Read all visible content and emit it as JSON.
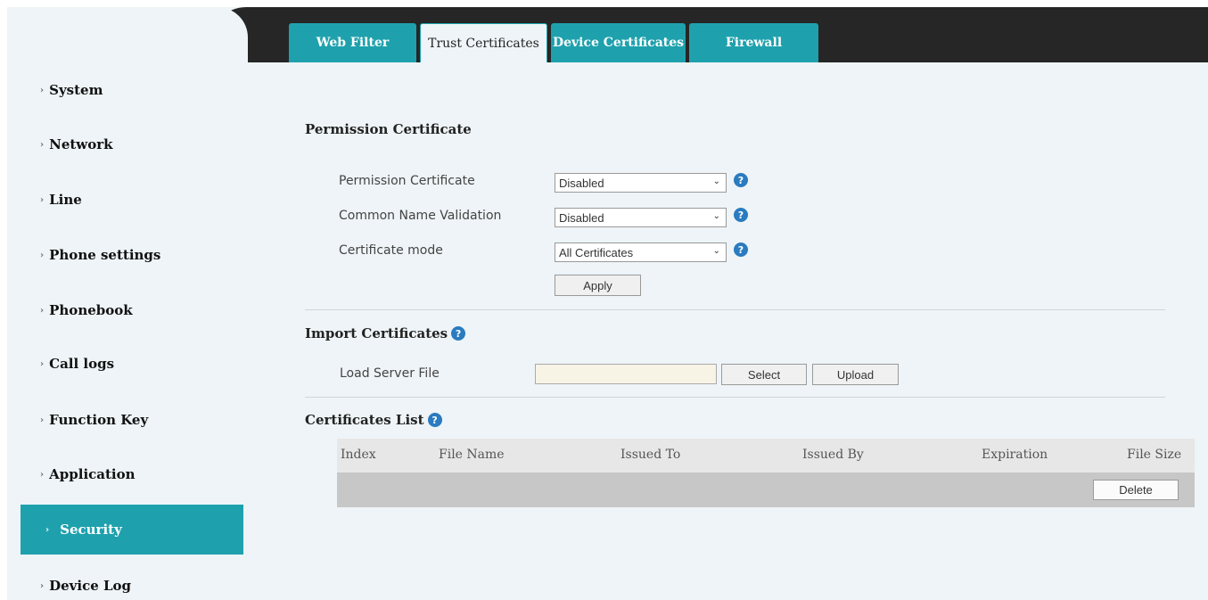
{
  "sidebar": {
    "items": [
      {
        "label": "System"
      },
      {
        "label": "Network"
      },
      {
        "label": "Line"
      },
      {
        "label": "Phone settings"
      },
      {
        "label": "Phonebook"
      },
      {
        "label": "Call logs"
      },
      {
        "label": "Function Key"
      },
      {
        "label": "Application"
      },
      {
        "label": "Security",
        "active": true
      },
      {
        "label": "Device Log"
      }
    ],
    "arrow": "›"
  },
  "tabs": [
    {
      "label": "Web Filter",
      "selected": false
    },
    {
      "label": "Trust Certificates",
      "selected": true
    },
    {
      "label": "Device Certificates",
      "selected": false
    },
    {
      "label": "Firewall",
      "selected": false
    }
  ],
  "permission": {
    "title": "Permission Certificate",
    "fields": [
      {
        "label": "Permission Certificate",
        "value": "Disabled"
      },
      {
        "label": "Common Name Validation",
        "value": "Disabled"
      },
      {
        "label": "Certificate mode",
        "value": "All Certificates"
      }
    ],
    "apply_label": "Apply"
  },
  "import": {
    "title": "Import Certificates",
    "label": "Load Server File",
    "file_value": "",
    "select_label": "Select",
    "upload_label": "Upload"
  },
  "list": {
    "title": "Certificates List",
    "columns": [
      "Index",
      "File Name",
      "Issued To",
      "Issued By",
      "Expiration",
      "File Size"
    ],
    "delete_label": "Delete"
  },
  "help_glyph": "?",
  "colors": {
    "accent": "#1ea1ad",
    "topbar": "#262626",
    "panel": "#eef4f7",
    "help": "#2a7bc0"
  }
}
